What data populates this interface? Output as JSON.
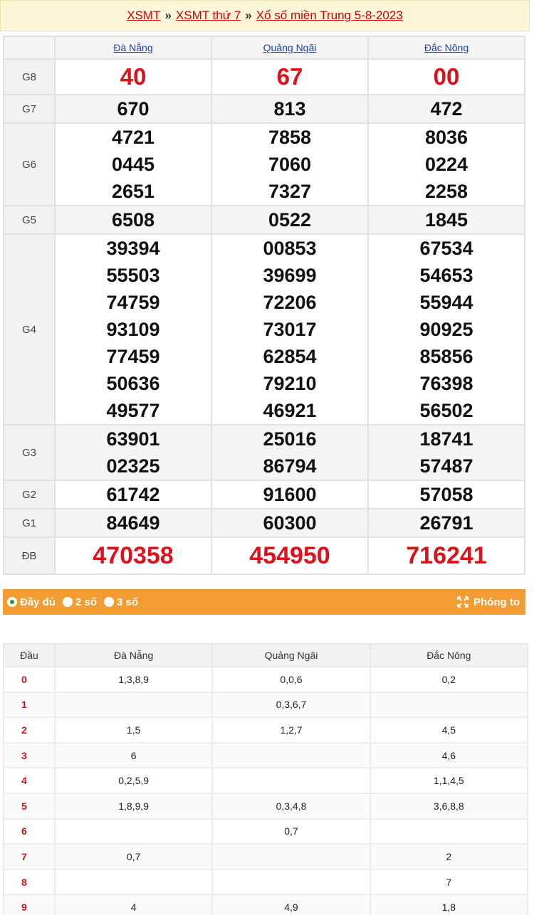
{
  "breadcrumb": {
    "items": [
      "XSMT",
      "XSMT thứ 7",
      "Xổ số miền Trung 5-8-2023"
    ],
    "separator": "»"
  },
  "provinces": [
    "Đà Nẵng",
    "Quảng Ngãi",
    "Đắc Nông"
  ],
  "prizes": [
    {
      "label": "G8",
      "values": [
        [
          "40"
        ],
        [
          "67"
        ],
        [
          "00"
        ]
      ]
    },
    {
      "label": "G7",
      "values": [
        [
          "670"
        ],
        [
          "813"
        ],
        [
          "472"
        ]
      ]
    },
    {
      "label": "G6",
      "values": [
        [
          "4721",
          "0445",
          "2651"
        ],
        [
          "7858",
          "7060",
          "7327"
        ],
        [
          "8036",
          "0224",
          "2258"
        ]
      ]
    },
    {
      "label": "G5",
      "values": [
        [
          "6508"
        ],
        [
          "0522"
        ],
        [
          "1845"
        ]
      ]
    },
    {
      "label": "G4",
      "values": [
        [
          "39394",
          "55503",
          "74759",
          "93109",
          "77459",
          "50636",
          "49577"
        ],
        [
          "00853",
          "39699",
          "72206",
          "73017",
          "62854",
          "79210",
          "46921"
        ],
        [
          "67534",
          "54653",
          "55944",
          "90925",
          "85856",
          "76398",
          "56502"
        ]
      ]
    },
    {
      "label": "G3",
      "values": [
        [
          "63901",
          "02325"
        ],
        [
          "25016",
          "86794"
        ],
        [
          "18741",
          "57487"
        ]
      ]
    },
    {
      "label": "G2",
      "values": [
        [
          "61742"
        ],
        [
          "91600"
        ],
        [
          "57058"
        ]
      ]
    },
    {
      "label": "G1",
      "values": [
        [
          "84649"
        ],
        [
          "60300"
        ],
        [
          "26791"
        ]
      ]
    },
    {
      "label": "ĐB",
      "values": [
        [
          "470358"
        ],
        [
          "454950"
        ],
        [
          "716241"
        ]
      ]
    }
  ],
  "options": {
    "full": "Đầy đủ",
    "two": "2 số",
    "three": "3 số",
    "zoom": "Phóng to"
  },
  "loto": {
    "headers": [
      "Đầu",
      "Đà Nẵng",
      "Quảng Ngãi",
      "Đắc Nông"
    ],
    "rows": [
      {
        "head": "0",
        "cols": [
          "1,3,8,9",
          "0,0,6",
          "0,2"
        ]
      },
      {
        "head": "1",
        "cols": [
          "",
          "0,3,6,7",
          ""
        ]
      },
      {
        "head": "2",
        "cols": [
          "1,5",
          "1,2,7",
          "4,5"
        ]
      },
      {
        "head": "3",
        "cols": [
          "6",
          "",
          "4,6"
        ]
      },
      {
        "head": "4",
        "cols": [
          "0,2,5,9",
          "",
          "1,1,4,5"
        ]
      },
      {
        "head": "5",
        "cols": [
          "1,8,9,9",
          "0,3,4,8",
          "3,6,8,8"
        ]
      },
      {
        "head": "6",
        "cols": [
          "",
          "0,7",
          ""
        ]
      },
      {
        "head": "7",
        "cols": [
          "0,7",
          "",
          "2"
        ]
      },
      {
        "head": "8",
        "cols": [
          "",
          "",
          "7"
        ]
      },
      {
        "head": "9",
        "cols": [
          "4",
          "4,9",
          "1,8"
        ]
      }
    ]
  },
  "colors": {
    "accent_red": "#e0101a",
    "bar_orange": "#f39c32",
    "link_blue": "#1a44a8",
    "breadcrumb_bg": "#fdf6d9"
  }
}
